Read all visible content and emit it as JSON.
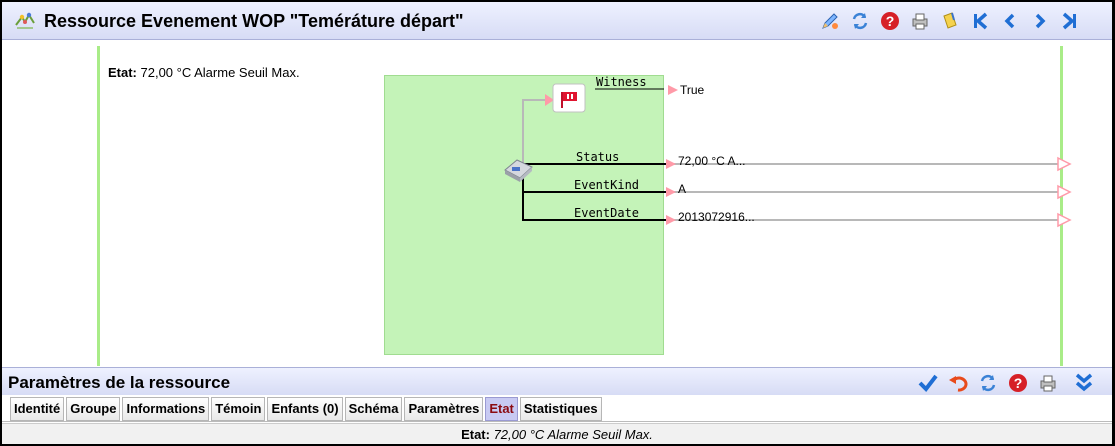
{
  "window": {
    "title": "Ressource Evenement WOP \"Teméráture départ\"",
    "toolbar": {
      "icons": [
        "edit-pencil-icon",
        "refresh-icon",
        "help-icon",
        "print-icon",
        "notes-icon",
        "first-icon",
        "previous-icon",
        "next-icon",
        "last-icon"
      ]
    }
  },
  "schema": {
    "etat_label": "Etat:",
    "etat_value": " 72,00 °C Alarme Seuil Max.",
    "witness": {
      "pin": "Witness",
      "value": "True"
    },
    "outputs": [
      {
        "pin": "Status",
        "value": "72,00 °C A..."
      },
      {
        "pin": "EventKind",
        "value": "A"
      },
      {
        "pin": "EventDate",
        "value": "2013072916..."
      }
    ]
  },
  "params": {
    "title": "Paramètres de la ressource",
    "toolbar": {
      "icons": [
        "validate-check-icon",
        "undo-icon",
        "refresh-icon",
        "help-icon",
        "print-icon",
        "collapse-icon"
      ]
    },
    "tabs": [
      {
        "label": "Identité",
        "active": false
      },
      {
        "label": "Groupe",
        "active": false
      },
      {
        "label": "Informations",
        "active": false
      },
      {
        "label": "Témoin",
        "active": false
      },
      {
        "label": "Enfants (0)",
        "active": false
      },
      {
        "label": "Schéma",
        "active": false
      },
      {
        "label": "Paramètres",
        "active": false
      },
      {
        "label": "Etat",
        "active": true
      },
      {
        "label": "Statistiques",
        "active": false
      }
    ],
    "status_label": "Etat:",
    "status_value": " 72,00 °C Alarme Seuil Max."
  },
  "colors": {
    "header_bg": "#d7dcf5",
    "schema_green": "#c4f3b8",
    "rail_green": "#a9ec88",
    "active_tab_bg": "#c8caf3",
    "active_tab_text": "#8b0b12",
    "link_arrow": "#ff9aa8"
  }
}
